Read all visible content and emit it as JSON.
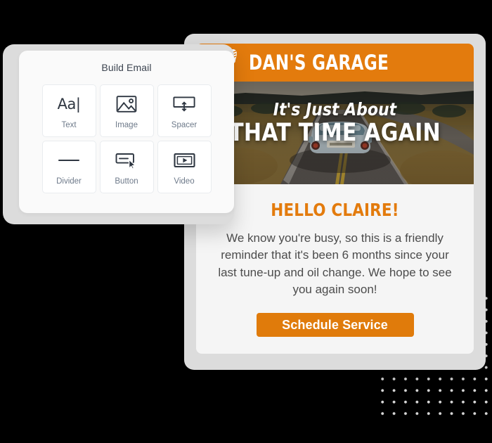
{
  "build_panel": {
    "title": "Build Email",
    "tiles": [
      {
        "label": "Text",
        "icon": "text-icon",
        "glyph": "Aa|"
      },
      {
        "label": "Image",
        "icon": "image-icon"
      },
      {
        "label": "Spacer",
        "icon": "spacer-icon"
      },
      {
        "label": "Divider",
        "icon": "divider-icon"
      },
      {
        "label": "Button",
        "icon": "button-icon"
      },
      {
        "label": "Video",
        "icon": "video-icon"
      }
    ]
  },
  "email": {
    "brand_name": "DAN'S GARAGE",
    "brand_icon": "wrench-screwdriver-icon",
    "hero": {
      "line1": "It's Just About",
      "line2": "THAT TIME AGAIN",
      "image": "car-on-winding-road-photo"
    },
    "greeting": "HELLO CLAIRE!",
    "message": "We know you're busy, so this is a friendly reminder that it's been 6 months since your last tune-up and oil change. We hope to see you again soon!",
    "cta_label": "Schedule Service"
  },
  "colors": {
    "brand_orange": "#e37b0d",
    "cta_orange": "#e07b0b",
    "frame_gray": "#dcdcdc",
    "body_text": "#4c4c4c",
    "tile_label": "#6e7a8a",
    "dot_gray": "#d6d6d6"
  }
}
